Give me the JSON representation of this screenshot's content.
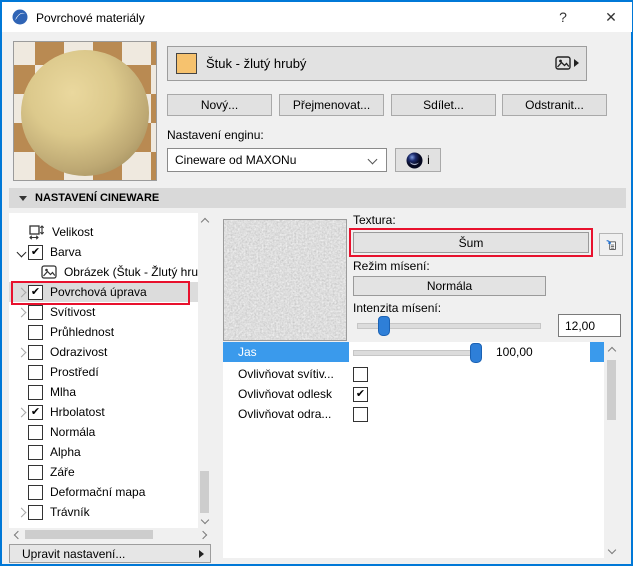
{
  "window": {
    "title": "Povrchové materiály",
    "help": "?",
    "close": "✕"
  },
  "material": {
    "name": "Štuk - žlutý hrubý",
    "swatch_color": "#f6c26e",
    "buttons": {
      "new": "Nový...",
      "rename": "Přejmenovat...",
      "share": "Sdílet...",
      "delete": "Odstranit..."
    }
  },
  "engine": {
    "label": "Nastavení enginu:",
    "value": "Cineware od MAXONu",
    "info": "i"
  },
  "section": {
    "title": "NASTAVENÍ CINEWARE"
  },
  "tree": {
    "edit_settings": "Upravit nastavení...",
    "items": [
      {
        "id": "velikost",
        "label": "Velikost",
        "control": "size-icon",
        "expander": null,
        "indent": 0
      },
      {
        "id": "barva",
        "label": "Barva",
        "control": "checkbox",
        "checked": true,
        "expander": "open",
        "indent": 0
      },
      {
        "id": "obrazek",
        "label": "Obrázek (Štuk - Žlutý hru",
        "control": "image-icon",
        "expander": null,
        "indent": 1
      },
      {
        "id": "povrchova-uprava",
        "label": "Povrchová úprava",
        "control": "checkbox",
        "checked": true,
        "expander": "closed",
        "indent": 0,
        "selected": true,
        "highlighted": true
      },
      {
        "id": "svitivost",
        "label": "Svítivost",
        "control": "checkbox",
        "checked": false,
        "expander": "closed",
        "indent": 0
      },
      {
        "id": "pruhlednost",
        "label": "Průhlednost",
        "control": "checkbox",
        "checked": false,
        "expander": null,
        "indent": 0
      },
      {
        "id": "odrazivost",
        "label": "Odrazivost",
        "control": "checkbox",
        "checked": false,
        "expander": "closed",
        "indent": 0
      },
      {
        "id": "prostredi",
        "label": "Prostředí",
        "control": "checkbox",
        "checked": false,
        "expander": null,
        "indent": 0
      },
      {
        "id": "mlha",
        "label": "Mlha",
        "control": "checkbox",
        "checked": false,
        "expander": null,
        "indent": 0
      },
      {
        "id": "hrbolatost",
        "label": "Hrbolatost",
        "control": "checkbox",
        "checked": true,
        "expander": "closed",
        "indent": 0
      },
      {
        "id": "normala",
        "label": "Normála",
        "control": "checkbox",
        "checked": false,
        "expander": null,
        "indent": 0
      },
      {
        "id": "alpha",
        "label": "Alpha",
        "control": "checkbox",
        "checked": false,
        "expander": null,
        "indent": 0
      },
      {
        "id": "zare",
        "label": "Záře",
        "control": "checkbox",
        "checked": false,
        "expander": null,
        "indent": 0
      },
      {
        "id": "deformacni-mapa",
        "label": "Deformační mapa",
        "control": "checkbox",
        "checked": false,
        "expander": null,
        "indent": 0
      },
      {
        "id": "travnik",
        "label": "Trávník",
        "control": "checkbox",
        "checked": false,
        "expander": "closed",
        "indent": 0
      }
    ]
  },
  "panel": {
    "texture_label": "Textura:",
    "texture_button": "Šum",
    "blend_label": "Režim mísení:",
    "blend_value": "Normála",
    "intensity_label": "Intenzita mísení:",
    "intensity_value": "12,00",
    "intensity_percent": 12,
    "properties": [
      {
        "id": "jas",
        "label": "Jas",
        "type": "slider",
        "value": "100,00",
        "percent": 100,
        "selected": true
      },
      {
        "id": "ovlivnovat-svitivost",
        "label": "Ovlivňovat svítiv...",
        "type": "checkbox",
        "checked": false
      },
      {
        "id": "ovlivnovat-odlesk",
        "label": "Ovlivňovat odlesk",
        "type": "checkbox",
        "checked": true
      },
      {
        "id": "ovlivnovat-odrazivost",
        "label": "Ovlivňovat odra...",
        "type": "checkbox",
        "checked": false
      }
    ]
  },
  "colors": {
    "accent_blue": "#3a9aec",
    "highlight_red": "#e8112d",
    "window_border": "#0078d7"
  }
}
